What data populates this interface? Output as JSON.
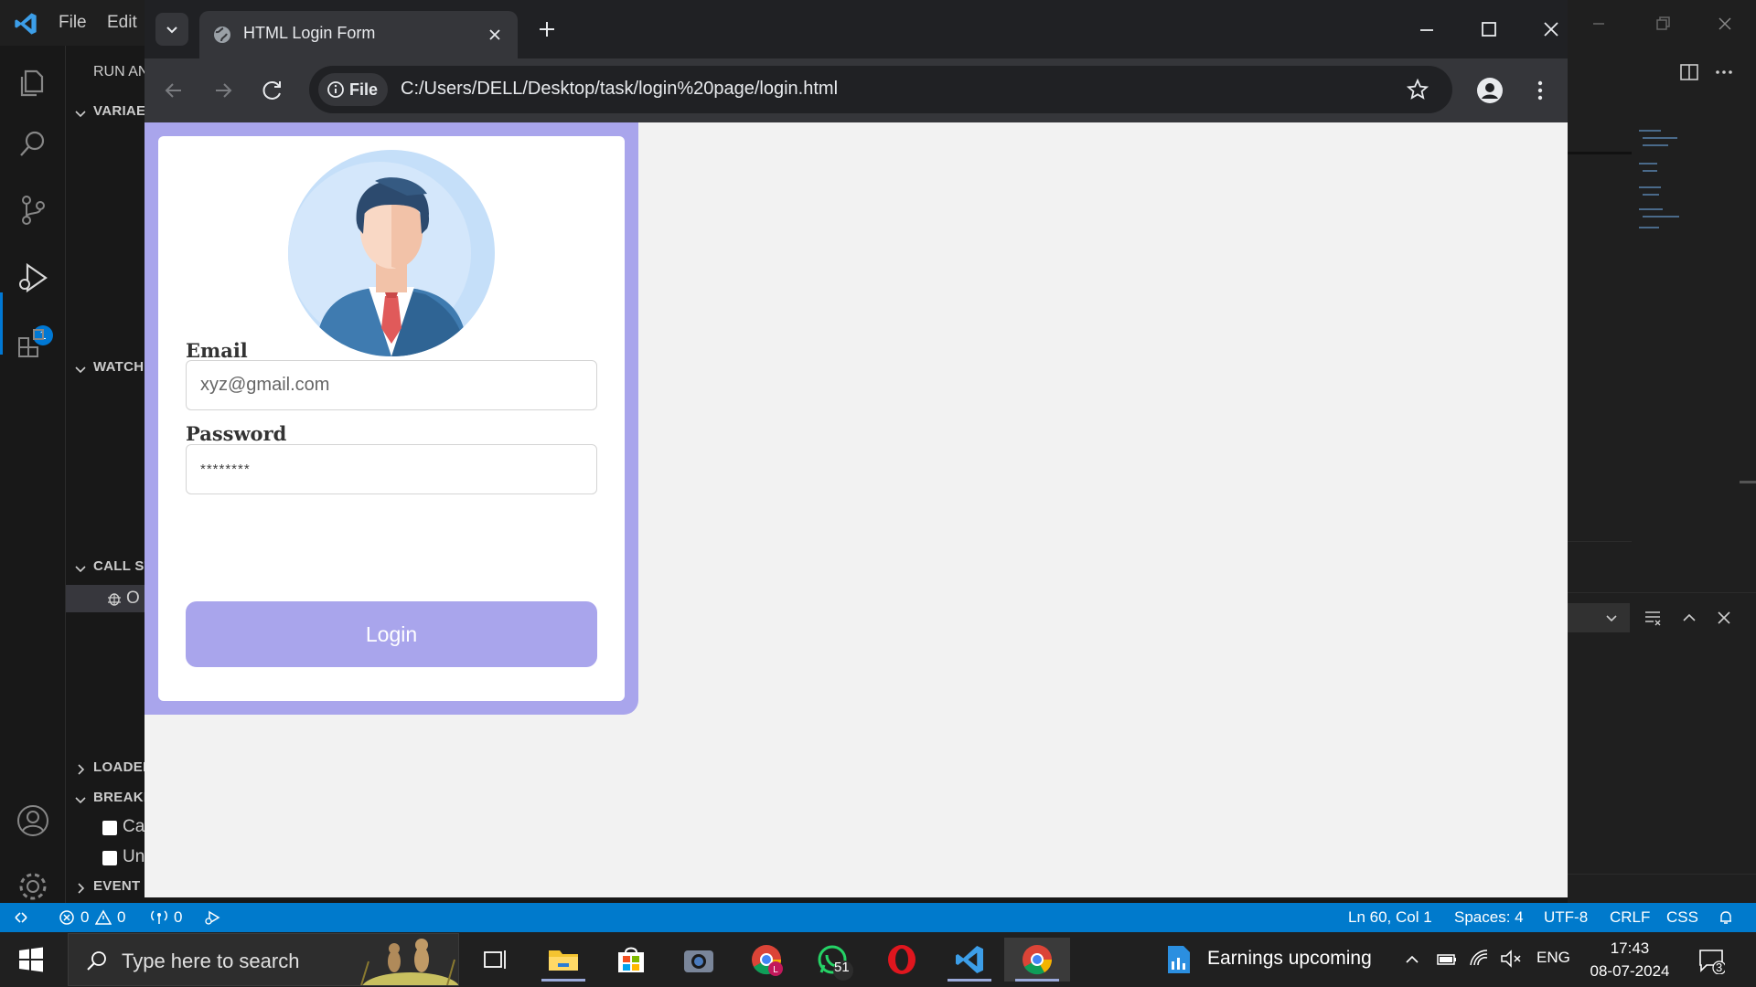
{
  "vscode": {
    "menu": [
      "File",
      "Edit"
    ],
    "sidebar": {
      "title": "RUN AN",
      "sections": {
        "variables": "VARIAE",
        "watch": "WATCH",
        "call_stack": "CALL ST",
        "call_stack_item": "O",
        "loaded": "LOADEI",
        "breakpoints": "BREAKI",
        "event": "EVENT"
      },
      "breakpoint_items": [
        "Ca",
        "Un"
      ]
    },
    "debug_badge": "1",
    "status_bar": {
      "errors": "0",
      "warnings": "0",
      "ports": "0",
      "position": "Ln 60, Col 1",
      "spaces": "Spaces: 4",
      "encoding": "UTF-8",
      "eol": "CRLF",
      "language": "CSS"
    }
  },
  "chrome": {
    "tab_title": "HTML Login Form",
    "chip_label": "File",
    "url": "C:/Users/DELL/Desktop/task/login%20page/login.html"
  },
  "login": {
    "email_label": "Email",
    "email_placeholder": "xyz@gmail.com",
    "password_label": "Password",
    "password_value": "********",
    "button_label": "Login"
  },
  "taskbar": {
    "search_placeholder": "Type here to search",
    "whatsapp_badge": "51",
    "news_text": "Earnings upcoming",
    "language": "ENG",
    "time": "17:43",
    "date": "08-07-2024",
    "notification_count": "3"
  },
  "colors": {
    "accent_purple": "#a9a5ec",
    "vscode_blue": "#007acc",
    "chrome_dark": "#202124"
  }
}
